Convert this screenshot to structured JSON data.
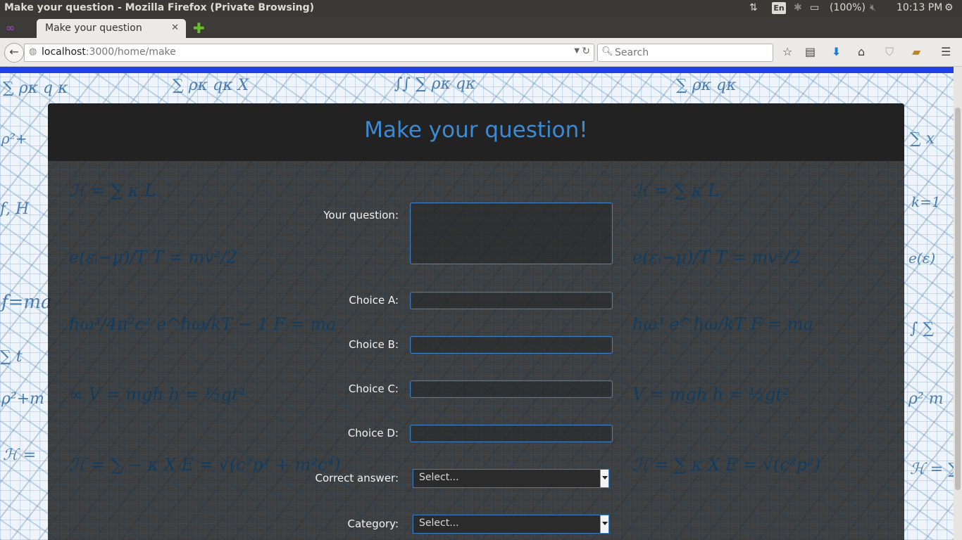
{
  "panel": {
    "window_title": "Make your question - Mozilla Firefox (Private Browsing)",
    "keyboard_lang": "En",
    "battery": "(100%)",
    "clock": "10:13 PM"
  },
  "tabs": {
    "active_title": "Make your question"
  },
  "navbar": {
    "url_host": "localhost",
    "url_path": ":3000/home/make",
    "search_placeholder": "Search"
  },
  "page": {
    "heading": "Make your question!",
    "form": {
      "question_label": "Your question:",
      "question_value": "",
      "choice_a_label": "Choice A:",
      "choice_a_value": "",
      "choice_b_label": "Choice B:",
      "choice_b_value": "",
      "choice_c_label": "Choice C:",
      "choice_c_value": "",
      "choice_d_label": "Choice D:",
      "choice_d_value": "",
      "correct_answer_label": "Correct answer:",
      "correct_answer_selected": "Select...",
      "category_label": "Category:",
      "category_selected": "Select..."
    }
  },
  "icons": {
    "mask": "private-browsing-mask-icon",
    "new_tab": "plus-icon",
    "back": "back-arrow-icon",
    "bookmark": "star-icon",
    "reading_list": "clipboard-icon",
    "downloads": "download-arrow-icon",
    "home": "home-icon",
    "menu": "hamburger-icon"
  },
  "colors": {
    "heading": "#3d8ad2",
    "input_border": "#3d7fc4",
    "top_bar_accent": "#1f3fe6"
  }
}
